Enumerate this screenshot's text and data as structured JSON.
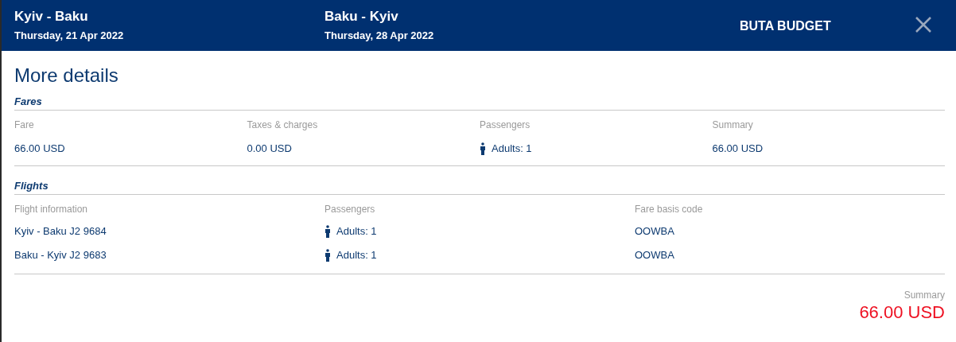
{
  "header": {
    "legs": [
      {
        "route": "Kyiv - Baku",
        "date": "Thursday, 21 Apr 2022"
      },
      {
        "route": "Baku - Kyiv",
        "date": "Thursday, 28 Apr 2022"
      }
    ],
    "fare_name": "BUTA BUDGET"
  },
  "title": "More details",
  "fares": {
    "heading": "Fares",
    "columns": [
      {
        "label": "Fare",
        "value": "66.00 USD",
        "kind": "text"
      },
      {
        "label": "Taxes & charges",
        "value": "0.00 USD",
        "kind": "text"
      },
      {
        "label": "Passengers",
        "value": "Adults: 1",
        "kind": "passengers"
      },
      {
        "label": "Summary",
        "value": "66.00 USD",
        "kind": "text"
      }
    ]
  },
  "flights": {
    "heading": "Flights",
    "columns": [
      "Flight information",
      "Passengers",
      "Fare basis code"
    ],
    "rows": [
      {
        "flight": "Kyiv - Baku J2 9684",
        "passengers": "Adults: 1",
        "fare_basis": "OOWBA"
      },
      {
        "flight": "Baku - Kyiv J2 9683",
        "passengers": "Adults: 1",
        "fare_basis": "OOWBA"
      }
    ]
  },
  "summary": {
    "label": "Summary",
    "total": "66.00 USD"
  }
}
